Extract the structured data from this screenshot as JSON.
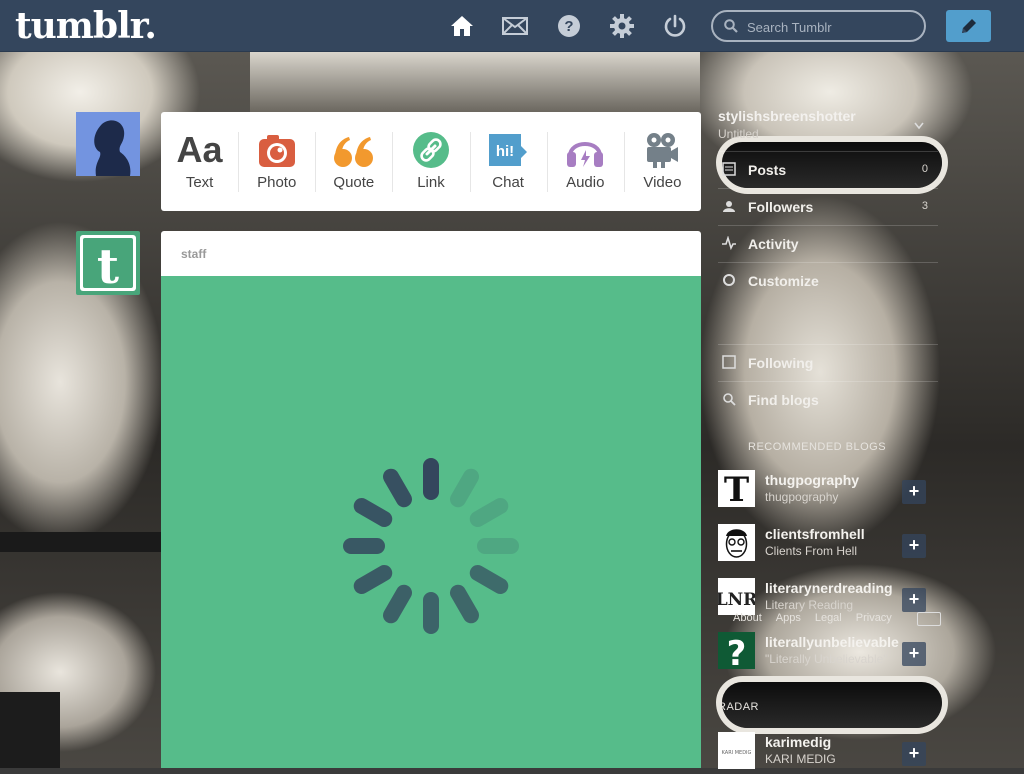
{
  "header": {
    "logo": "tumblr.",
    "nav": [
      {
        "name": "home-icon",
        "label": "Dashboard"
      },
      {
        "name": "mail-icon",
        "label": "Messages"
      },
      {
        "name": "help-icon",
        "label": "Help"
      },
      {
        "name": "gear-icon",
        "label": "Settings"
      },
      {
        "name": "power-icon",
        "label": "Log out"
      }
    ],
    "search_placeholder": "Search Tumblr",
    "compose_icon": "pencil-icon",
    "color_bg": "#34465d",
    "color_accent": "#529ecc"
  },
  "post_types": [
    {
      "label": "Text",
      "icon": "text-icon",
      "color": "#444444",
      "glyph": "Aa"
    },
    {
      "label": "Photo",
      "icon": "camera-icon",
      "color": "#d95e40"
    },
    {
      "label": "Quote",
      "icon": "quote-icon",
      "color": "#f2992e"
    },
    {
      "label": "Link",
      "icon": "link-icon",
      "color": "#56bc8a"
    },
    {
      "label": "Chat",
      "icon": "chat-icon",
      "color": "#529ecc",
      "glyph": "hi!"
    },
    {
      "label": "Audio",
      "icon": "headphones-icon",
      "color": "#a77dc2"
    },
    {
      "label": "Video",
      "icon": "video-camera-icon",
      "color": "#748089"
    }
  ],
  "post": {
    "author": "staff",
    "body_color": "#56bc8a",
    "state": "loading-spinner"
  },
  "sidebar": {
    "account_name": "stylishsbreenshotter",
    "account_subtitle": "Untitled",
    "rows": [
      {
        "label": "Posts",
        "count": "0",
        "icon": "posts-icon"
      },
      {
        "label": "Followers",
        "count": "3",
        "icon": "followers-icon"
      },
      {
        "label": "Activity",
        "count": "",
        "icon": "activity-icon"
      },
      {
        "label": "Customize",
        "count": "",
        "icon": "customize-icon"
      }
    ],
    "rows2": [
      {
        "label": "Following",
        "icon": "following-icon"
      },
      {
        "label": "Find blogs",
        "icon": "find-blogs-icon"
      }
    ],
    "recommended_header": "RECOMMENDED BLOGS",
    "recommended": [
      {
        "name": "thugpography",
        "subtitle": "thugpography",
        "follow": "+",
        "thumb": "T"
      },
      {
        "name": "clientsfromhell",
        "subtitle": "Clients From Hell",
        "follow": "+",
        "thumb": "face"
      },
      {
        "name": "literarynerdreading",
        "subtitle": "Literary Reading",
        "follow": "+",
        "thumb": "LNR"
      },
      {
        "name": "literallyunbelievable",
        "subtitle": "\"Literally Unbelievable\"",
        "follow": "+",
        "thumb": "?"
      }
    ],
    "radar_header": "RADAR",
    "radar": {
      "name": "karimedig",
      "subtitle": "KARI MEDIG",
      "follow": "+",
      "thumb": "KARI MEDIG"
    },
    "footer_links": [
      "About",
      "Apps",
      "Legal",
      "Privacy"
    ]
  }
}
